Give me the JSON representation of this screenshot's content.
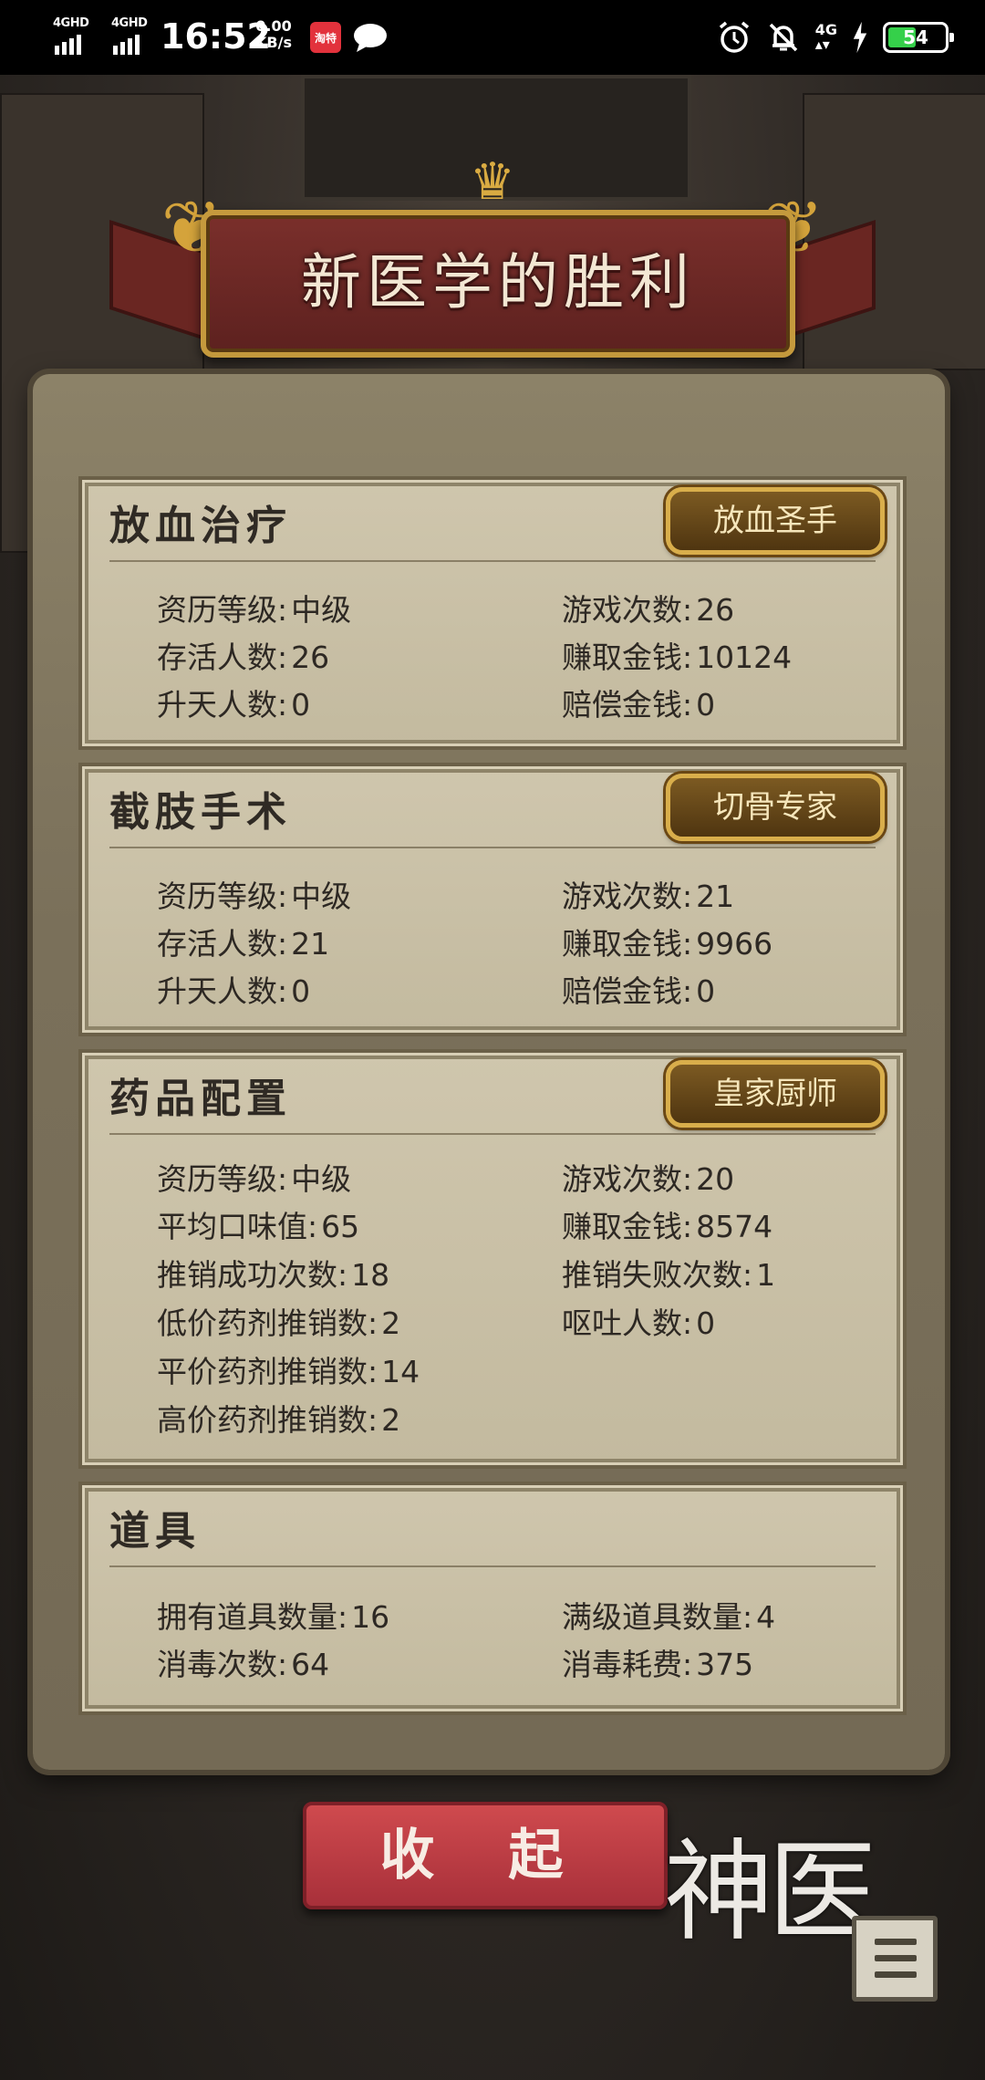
{
  "status_bar": {
    "net1": "4GHD",
    "net2": "4GHD",
    "time": "16:52",
    "speed_value": "0.00",
    "speed_unit": "KB/s",
    "app_icon_text": "淘特",
    "network_type": "4G",
    "battery": "54",
    "battery_level_percent": 54
  },
  "banner": {
    "title": "新医学的胜利"
  },
  "sections": [
    {
      "title": "放血治疗",
      "badge": "放血圣手",
      "stats": [
        {
          "label": "资历等级:",
          "value": "中级"
        },
        {
          "label": "游戏次数:",
          "value": "26"
        },
        {
          "label": "存活人数:",
          "value": "26"
        },
        {
          "label": "赚取金钱:",
          "value": "10124"
        },
        {
          "label": "升天人数:",
          "value": "0"
        },
        {
          "label": "赔偿金钱:",
          "value": "0"
        }
      ]
    },
    {
      "title": "截肢手术",
      "badge": "切骨专家",
      "stats": [
        {
          "label": "资历等级:",
          "value": "中级"
        },
        {
          "label": "游戏次数:",
          "value": "21"
        },
        {
          "label": "存活人数:",
          "value": "21"
        },
        {
          "label": "赚取金钱:",
          "value": "9966"
        },
        {
          "label": "升天人数:",
          "value": "0"
        },
        {
          "label": "赔偿金钱:",
          "value": "0"
        }
      ]
    },
    {
      "title": "药品配置",
      "badge": "皇家厨师",
      "stats": [
        {
          "label": "资历等级:",
          "value": "中级"
        },
        {
          "label": "游戏次数:",
          "value": "20"
        },
        {
          "label": "平均口味值:",
          "value": "65"
        },
        {
          "label": "赚取金钱:",
          "value": "8574"
        },
        {
          "label": "推销成功次数:",
          "value": "18"
        },
        {
          "label": "推销失败次数:",
          "value": "1"
        },
        {
          "label": "低价药剂推销数:",
          "value": "2"
        },
        {
          "label": "呕吐人数:",
          "value": "0"
        },
        {
          "label": "平价药剂推销数:",
          "value": "14"
        },
        {
          "label": "高价药剂推销数:",
          "value": "2"
        }
      ]
    },
    {
      "title": "道具",
      "stats": [
        {
          "label": "拥有道具数量:",
          "value": "16"
        },
        {
          "label": "满级道具数量:",
          "value": "4"
        },
        {
          "label": "消毒次数:",
          "value": "64"
        },
        {
          "label": "消毒耗费:",
          "value": "375"
        }
      ]
    }
  ],
  "collapse_button": "收 起",
  "logo_text": "神医",
  "icons": {
    "alarm": "alarm-icon",
    "mute": "bell-off-icon",
    "charging": "lightning-icon",
    "chat": "chat-bubble-icon",
    "menu": "menu-icon"
  }
}
